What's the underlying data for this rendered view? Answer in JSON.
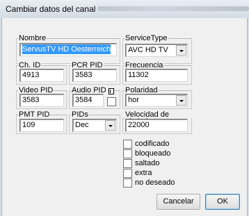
{
  "window": {
    "title": "Cambiar datos del canal"
  },
  "fields": {
    "nombre": {
      "label": "Nombre",
      "value": "ServusTV HD Oesterreich"
    },
    "service_type": {
      "label": "ServiceType",
      "value": "AVC HD TV"
    },
    "ch_id": {
      "label": "Ch. ID",
      "value": "4913"
    },
    "pcr_pid": {
      "label": "PCR PID",
      "value": "3583"
    },
    "frecuencia": {
      "label": "Frecuencia",
      "value": "11302"
    },
    "video_pid": {
      "label": "Video PID",
      "value": "3583"
    },
    "audio_pid": {
      "label": "Audio PID",
      "value": "3584"
    },
    "polaridad": {
      "label": "Polaridad",
      "value": "hor"
    },
    "pmt_pid": {
      "label": "PMT PID",
      "value": "109"
    },
    "pids": {
      "label": "PIDs",
      "value": "Dec"
    },
    "velocidad": {
      "label": "Velocidad de símbolo",
      "value": "22000"
    }
  },
  "checkboxes": [
    {
      "label": "codificado",
      "checked": false
    },
    {
      "label": "bloqueado",
      "checked": false
    },
    {
      "label": "saltado",
      "checked": false
    },
    {
      "label": "extra",
      "checked": false
    },
    {
      "label": "no deseado",
      "checked": false
    }
  ],
  "buttons": {
    "cancel": "Cancelar",
    "ok": "OK"
  }
}
